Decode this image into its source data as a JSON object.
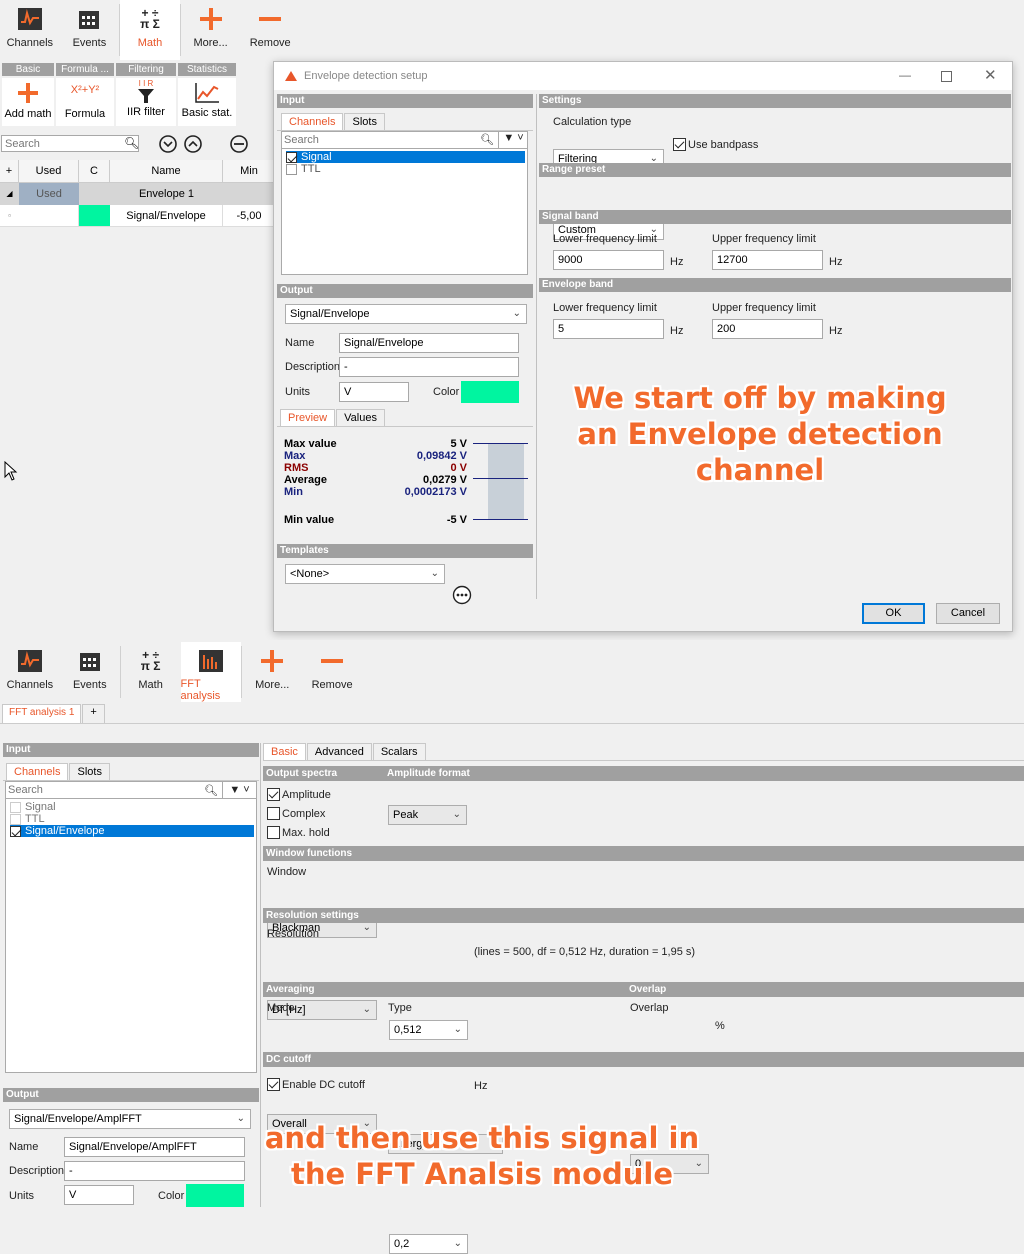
{
  "top_ribbon": {
    "channels": "Channels",
    "events": "Events",
    "math": "Math",
    "more": "More...",
    "remove": "Remove"
  },
  "math_toolbar": {
    "groups": [
      "Basic",
      "Formula ...",
      "Filtering",
      "Statistics"
    ],
    "add_math": "Add math",
    "formula": "Formula",
    "formula_icon": "X²+Y²",
    "iir_filter": "IIR filter",
    "iir_icon": "I I R",
    "basic_stat": "Basic stat."
  },
  "left_search": {
    "placeholder": "Search"
  },
  "channel_table": {
    "headers": [
      "+",
      "Used",
      "C",
      "Name",
      "Min"
    ],
    "group_row": {
      "used": "Used",
      "name": "Envelope 1"
    },
    "row": {
      "name": "Signal/Envelope",
      "min": "-5,00"
    }
  },
  "dialog": {
    "title": "Envelope detection setup",
    "input_header": "Input",
    "tabs": [
      "Channels",
      "Slots"
    ],
    "search_placeholder": "Search",
    "channels": [
      {
        "name": "Signal",
        "checked": true
      },
      {
        "name": "TTL",
        "checked": false
      }
    ],
    "output_header": "Output",
    "output_select": "Signal/Envelope",
    "name_label": "Name",
    "name_value": "Signal/Envelope",
    "desc_label": "Description",
    "desc_value": "-",
    "units_label": "Units",
    "units_value": "V",
    "color_label": "Color",
    "color": "#00f5a0",
    "preview_tabs": [
      "Preview",
      "Values"
    ],
    "preview": [
      {
        "label": "Max value",
        "value": "5 V",
        "color": "#000"
      },
      {
        "label": "Max",
        "value": "0,09842 V",
        "color": "#1a237e"
      },
      {
        "label": "RMS",
        "value": "0 V",
        "color": "#8b0000"
      },
      {
        "label": "Average",
        "value": "0,0279 V",
        "color": "#000"
      },
      {
        "label": "Min",
        "value": "0,0002173 V",
        "color": "#1a237e"
      },
      {
        "label": "Min value",
        "value": "-5 V",
        "color": "#000"
      }
    ],
    "templates_header": "Templates",
    "template_select": "<None>",
    "settings_header": "Settings",
    "calc_type_label": "Calculation type",
    "calc_type": "Filtering",
    "use_bandpass": "Use bandpass",
    "range_preset_header": "Range preset",
    "range_preset": "Custom",
    "signal_band_header": "Signal band",
    "lower_label": "Lower frequency limit",
    "upper_label": "Upper frequency limit",
    "hz": "Hz",
    "signal_lower": "9000",
    "signal_upper": "12700",
    "envelope_band_header": "Envelope band",
    "envelope_lower": "5",
    "envelope_upper": "200",
    "ok": "OK",
    "cancel": "Cancel"
  },
  "overlay_top": [
    "We start off by making",
    "an Envelope detection",
    "channel"
  ],
  "bottom_ribbon": {
    "channels": "Channels",
    "events": "Events",
    "math": "Math",
    "fft": "FFT analysis",
    "more": "More...",
    "remove": "Remove"
  },
  "fft_tab": "FFT analysis 1",
  "add_tab": "+",
  "fft_input": {
    "header": "Input",
    "tabs": [
      "Channels",
      "Slots"
    ],
    "search_placeholder": "Search",
    "channels": [
      {
        "name": "Signal",
        "checked": false
      },
      {
        "name": "TTL",
        "checked": false
      },
      {
        "name": "Signal/Envelope",
        "checked": true
      }
    ]
  },
  "fft_output": {
    "header": "Output",
    "select": "Signal/Envelope/AmplFFT",
    "name_label": "Name",
    "name_value": "Signal/Envelope/AmplFFT",
    "desc_label": "Description",
    "desc_value": "-",
    "units_label": "Units",
    "units_value": "V",
    "color_label": "Color",
    "color": "#00f5a0"
  },
  "fft_settings": {
    "tabs": [
      "Basic",
      "Advanced",
      "Scalars"
    ],
    "output_spectra_header": "Output spectra",
    "amplitude_format_header": "Amplitude format",
    "amplitude": "Amplitude",
    "complex": "Complex",
    "max_hold": "Max. hold",
    "amp_format": "Peak",
    "window_functions_header": "Window functions",
    "window_label": "Window",
    "window": "Blackman",
    "resolution_header": "Resolution settings",
    "resolution_label": "Resolution",
    "res_type": "Df [Hz]",
    "res_value": "0,512",
    "res_info": "(lines = 500, df = 0,512 Hz, duration = 1,95 s)",
    "averaging_header": "Averaging",
    "overlap_header": "Overlap",
    "mode_label": "Mode",
    "mode": "Overall",
    "type_label": "Type",
    "type": "Energy",
    "overlap_label": "Overlap",
    "overlap": "0",
    "percent": "%",
    "dc_cutoff_header": "DC cutoff",
    "enable_dc": "Enable DC cutoff",
    "dc_value": "0,2",
    "hz": "Hz"
  },
  "overlay_bottom": [
    "and then use this signal in",
    "the FFT Analsis module"
  ]
}
